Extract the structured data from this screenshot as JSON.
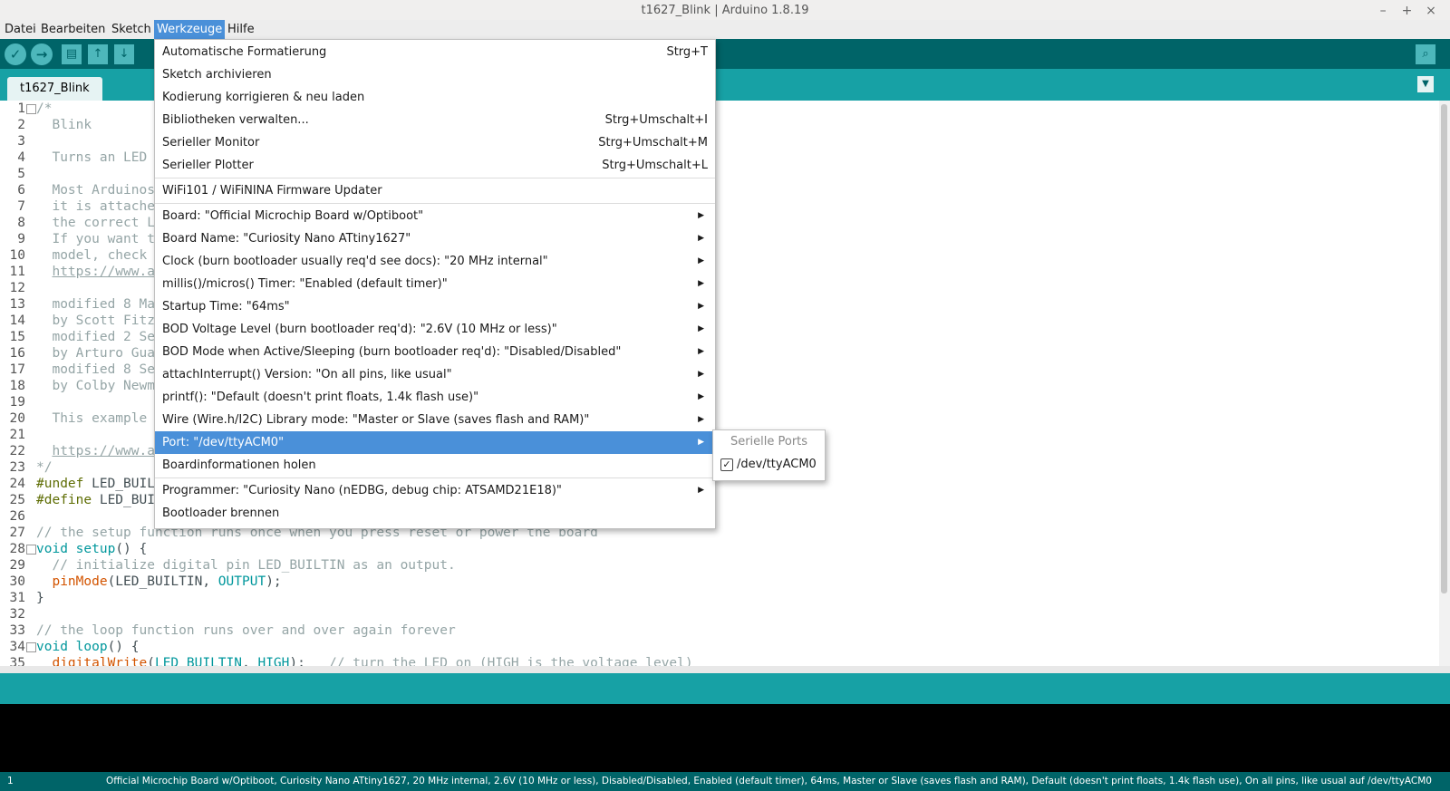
{
  "window": {
    "title": "t1627_Blink | Arduino 1.8.19",
    "minimize": "–",
    "maximize": "+",
    "close": "×"
  },
  "menubar": {
    "items": [
      "Datei",
      "Bearbeiten",
      "Sketch",
      "Werkzeuge",
      "Hilfe"
    ]
  },
  "toolbar": {
    "verify": "✓",
    "upload": "→",
    "new": "▤",
    "open": "↑",
    "save": "↓",
    "serial_monitor": "⌕"
  },
  "tab": {
    "name": "t1627_Blink",
    "menu": "▼"
  },
  "editor": {
    "lines": [
      {
        "n": "1",
        "fold": "⊟",
        "segs": [
          {
            "c": "comment",
            "t": "/*"
          }
        ]
      },
      {
        "n": "2",
        "segs": [
          {
            "c": "comment",
            "t": "  Blink"
          }
        ]
      },
      {
        "n": "3",
        "segs": []
      },
      {
        "n": "4",
        "segs": [
          {
            "c": "comment",
            "t": "  Turns an LED"
          }
        ]
      },
      {
        "n": "5",
        "segs": []
      },
      {
        "n": "6",
        "segs": [
          {
            "c": "comment",
            "t": "  Most Arduinos"
          }
        ]
      },
      {
        "n": "7",
        "segs": [
          {
            "c": "comment",
            "t": "  it is attache"
          }
        ]
      },
      {
        "n": "8",
        "segs": [
          {
            "c": "comment",
            "t": "  the correct L"
          }
        ]
      },
      {
        "n": "9",
        "segs": [
          {
            "c": "comment",
            "t": "  If you want t"
          }
        ]
      },
      {
        "n": "10",
        "segs": [
          {
            "c": "comment",
            "t": "  model, check "
          }
        ]
      },
      {
        "n": "11",
        "segs": [
          {
            "c": "comment",
            "t": "  "
          },
          {
            "c": "link",
            "t": "https://www.a"
          }
        ]
      },
      {
        "n": "12",
        "segs": []
      },
      {
        "n": "13",
        "segs": [
          {
            "c": "comment",
            "t": "  modified 8 Ma"
          }
        ]
      },
      {
        "n": "14",
        "segs": [
          {
            "c": "comment",
            "t": "  by Scott Fitz"
          }
        ]
      },
      {
        "n": "15",
        "segs": [
          {
            "c": "comment",
            "t": "  modified 2 Se"
          }
        ]
      },
      {
        "n": "16",
        "segs": [
          {
            "c": "comment",
            "t": "  by Arturo Gua"
          }
        ]
      },
      {
        "n": "17",
        "segs": [
          {
            "c": "comment",
            "t": "  modified 8 Se"
          }
        ]
      },
      {
        "n": "18",
        "segs": [
          {
            "c": "comment",
            "t": "  by Colby Newm"
          }
        ]
      },
      {
        "n": "19",
        "segs": []
      },
      {
        "n": "20",
        "segs": [
          {
            "c": "comment",
            "t": "  This example"
          }
        ]
      },
      {
        "n": "21",
        "segs": []
      },
      {
        "n": "22",
        "segs": [
          {
            "c": "comment",
            "t": "  "
          },
          {
            "c": "link",
            "t": "https://www.a"
          }
        ]
      },
      {
        "n": "23",
        "segs": [
          {
            "c": "comment",
            "t": "*/"
          }
        ]
      },
      {
        "n": "24",
        "segs": [
          {
            "c": "pre",
            "t": "#undef"
          },
          {
            "c": "plain",
            "t": " LED_BUIL"
          }
        ]
      },
      {
        "n": "25",
        "segs": [
          {
            "c": "pre",
            "t": "#define"
          },
          {
            "c": "plain",
            "t": " LED_BUI"
          }
        ]
      },
      {
        "n": "26",
        "segs": []
      },
      {
        "n": "27",
        "segs": [
          {
            "c": "comment",
            "t": "// the setup function runs once when you press reset or power the board"
          }
        ]
      },
      {
        "n": "28",
        "fold": "⊟",
        "segs": [
          {
            "c": "kw",
            "t": "void"
          },
          {
            "c": "plain",
            "t": " "
          },
          {
            "c": "kw",
            "t": "setup"
          },
          {
            "c": "plain",
            "t": "() {"
          }
        ]
      },
      {
        "n": "29",
        "segs": [
          {
            "c": "comment",
            "t": "  // initialize digital pin LED_BUILTIN as an output."
          }
        ]
      },
      {
        "n": "30",
        "segs": [
          {
            "c": "plain",
            "t": "  "
          },
          {
            "c": "fn",
            "t": "pinMode"
          },
          {
            "c": "plain",
            "t": "(LED_BUILTIN, "
          },
          {
            "c": "kw",
            "t": "OUTPUT"
          },
          {
            "c": "plain",
            "t": ");"
          }
        ]
      },
      {
        "n": "31",
        "segs": [
          {
            "c": "plain",
            "t": "}"
          }
        ]
      },
      {
        "n": "32",
        "segs": []
      },
      {
        "n": "33",
        "segs": [
          {
            "c": "comment",
            "t": "// the loop function runs over and over again forever"
          }
        ]
      },
      {
        "n": "34",
        "fold": "⊟",
        "segs": [
          {
            "c": "kw",
            "t": "void"
          },
          {
            "c": "plain",
            "t": " "
          },
          {
            "c": "kw",
            "t": "loop"
          },
          {
            "c": "plain",
            "t": "() {"
          }
        ]
      },
      {
        "n": "35",
        "segs": [
          {
            "c": "plain",
            "t": "  "
          },
          {
            "c": "fn",
            "t": "digitalWrite"
          },
          {
            "c": "plain",
            "t": "("
          },
          {
            "c": "kw",
            "t": "LED_BUILTIN"
          },
          {
            "c": "plain",
            "t": ", "
          },
          {
            "c": "kw",
            "t": "HIGH"
          },
          {
            "c": "plain",
            "t": ");   "
          },
          {
            "c": "comment",
            "t": "// turn the LED on (HIGH is the voltage level)"
          }
        ]
      }
    ]
  },
  "menu": {
    "items": [
      {
        "label": "Automatische Formatierung",
        "shortcut": "Strg+T"
      },
      {
        "label": "Sketch archivieren",
        "shortcut": ""
      },
      {
        "label": "Kodierung korrigieren & neu laden",
        "shortcut": ""
      },
      {
        "label": "Bibliotheken verwalten...",
        "shortcut": "Strg+Umschalt+I"
      },
      {
        "label": "Serieller Monitor",
        "shortcut": "Strg+Umschalt+M"
      },
      {
        "label": "Serieller Plotter",
        "shortcut": "Strg+Umschalt+L"
      },
      {
        "sep": true
      },
      {
        "label": "WiFi101 / WiFiNINA Firmware Updater",
        "shortcut": ""
      },
      {
        "sep": true
      },
      {
        "label": "Board: \"Official Microchip Board w/Optiboot\"",
        "sub": true
      },
      {
        "label": "Board Name: \"Curiosity Nano ATtiny1627\"",
        "sub": true
      },
      {
        "label": "Clock (burn bootloader usually req'd see docs): \"20 MHz internal\"",
        "sub": true
      },
      {
        "label": "millis()/micros() Timer: \"Enabled (default timer)\"",
        "sub": true
      },
      {
        "label": "Startup Time: \"64ms\"",
        "sub": true
      },
      {
        "label": "BOD Voltage Level (burn bootloader req'd): \"2.6V (10 MHz or less)\"",
        "sub": true
      },
      {
        "label": "BOD Mode when Active/Sleeping (burn bootloader req'd): \"Disabled/Disabled\"",
        "sub": true
      },
      {
        "label": "attachInterrupt() Version: \"On all pins, like usual\"",
        "sub": true
      },
      {
        "label": "printf(): \"Default (doesn't print floats, 1.4k flash use)\"",
        "sub": true
      },
      {
        "label": "Wire (Wire.h/I2C) Library mode: \"Master or Slave (saves flash and RAM)\"",
        "sub": true
      },
      {
        "label": "Port: \"/dev/ttyACM0\"",
        "sub": true,
        "active": true
      },
      {
        "label": "Boardinformationen holen"
      },
      {
        "sep": true
      },
      {
        "label": "Programmer: \"Curiosity Nano (nEDBG, debug chip: ATSAMD21E18)\"",
        "sub": true
      },
      {
        "label": "Bootloader brennen"
      }
    ],
    "arrow": "▶"
  },
  "submenu": {
    "header": "Serielle Ports",
    "item": "/dev/ttyACM0",
    "checked": "✓"
  },
  "statusbar": {
    "line": "1",
    "board": "Official Microchip Board w/Optiboot, Curiosity Nano ATtiny1627, 20 MHz internal, 2.6V (10 MHz or less), Disabled/Disabled, Enabled (default timer), 64ms, Master or Slave (saves flash and RAM), Default (doesn't print floats, 1.4k flash use), On all pins, like usual auf /dev/ttyACM0"
  }
}
